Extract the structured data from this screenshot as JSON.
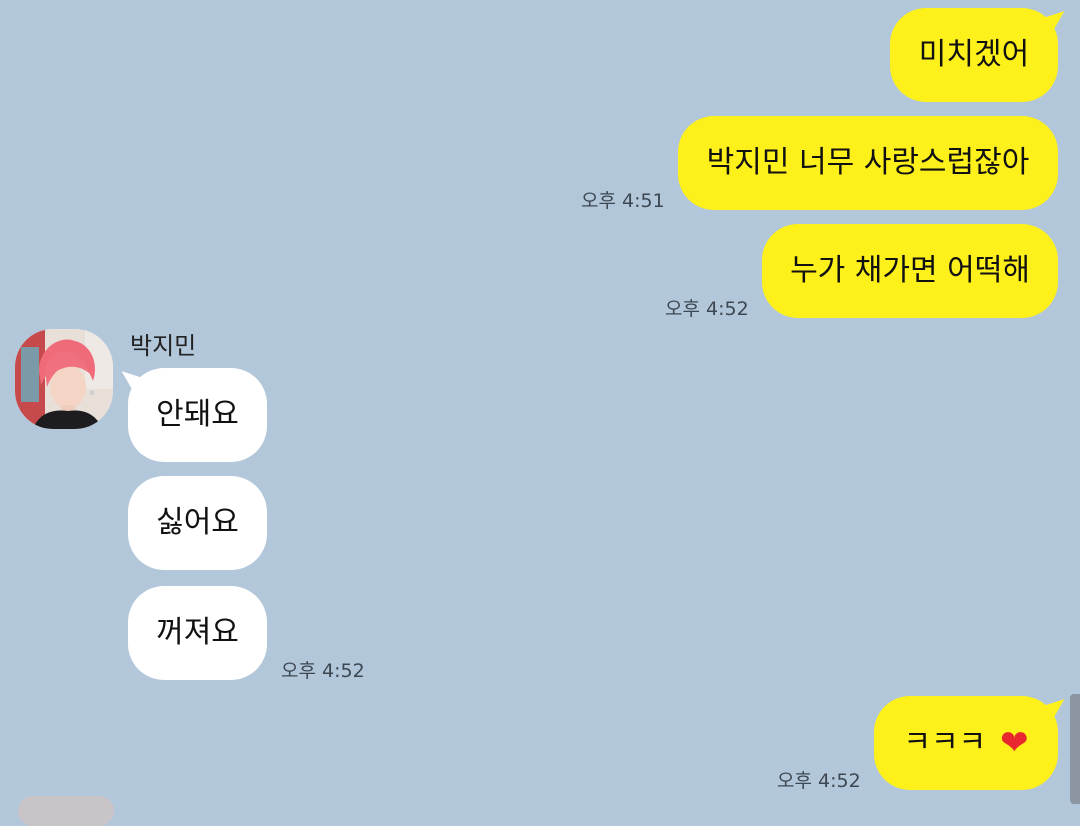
{
  "conversation": {
    "outgoing_1": {
      "text": "미치겠어"
    },
    "outgoing_2": {
      "text": "박지민 너무 사랑스럽잖아",
      "time": "오후 4:51"
    },
    "outgoing_3": {
      "text": "누가 채가면 어떡해",
      "time": "오후 4:52"
    },
    "incoming": {
      "sender": "박지민",
      "messages": [
        "안돼요",
        "싫어요",
        "꺼져요"
      ],
      "time": "오후 4:52"
    },
    "outgoing_4": {
      "text": "ㅋㅋㅋ",
      "emoji": "❤",
      "time": "오후 4:52"
    }
  },
  "colors": {
    "background": "#b2c7da",
    "outgoing_bubble": "#fef01b",
    "incoming_bubble": "#ffffff",
    "heart": "#e8272e"
  },
  "icons": {
    "avatar": "profile-photo",
    "heart": "heart-emoji"
  }
}
